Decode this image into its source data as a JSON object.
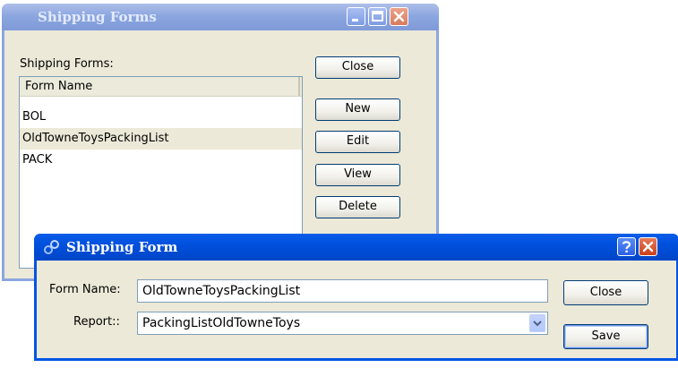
{
  "forms_window": {
    "title": "Shipping Forms",
    "list_label": "Shipping Forms:",
    "column_header": "Form Name",
    "rows": [
      "BOL",
      "OldTowneToysPackingList",
      "PACK"
    ],
    "selected_index": 1,
    "buttons": {
      "close": "Close",
      "new": "New",
      "edit": "Edit",
      "view": "View",
      "delete": "Delete"
    },
    "controls": {
      "minimize": "minimize-icon",
      "maximize": "maximize-icon",
      "close": "close-icon"
    }
  },
  "form_dialog": {
    "title": "Shipping Form",
    "form_name_label": "Form Name:",
    "form_name_value": "OldTowneToysPackingList",
    "report_label": "Report::",
    "report_value": "PackingListOldTowneToys",
    "buttons": {
      "close": "Close",
      "save": "Save"
    },
    "controls": {
      "help": "help-icon",
      "close": "close-icon"
    }
  },
  "colors": {
    "titlebar_active": "#0054e3",
    "titlebar_inactive": "#8ca6e0",
    "window_face": "#ece9d8",
    "close_red": "#c9401c"
  }
}
